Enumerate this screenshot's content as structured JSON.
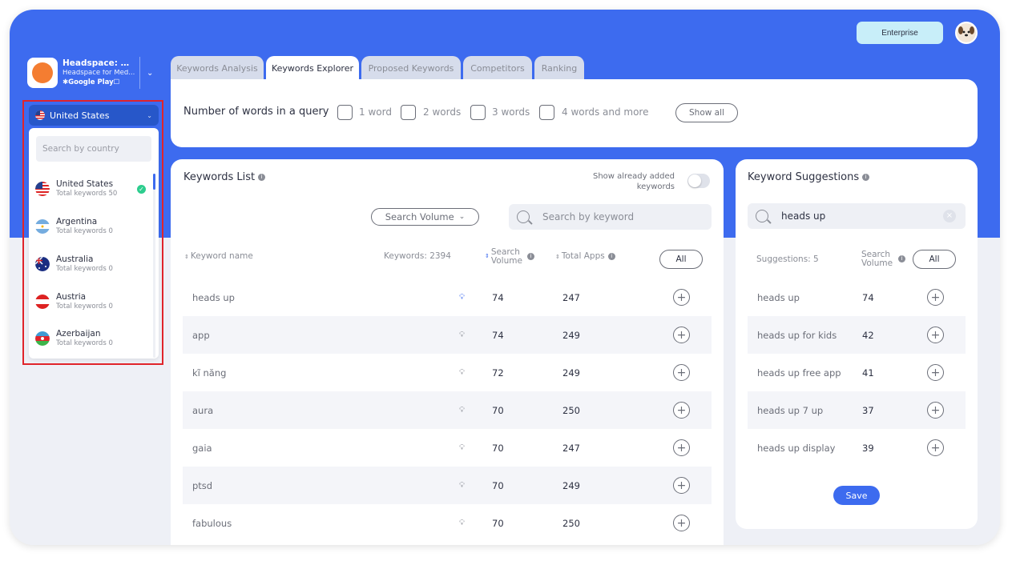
{
  "header": {
    "enterprise_label": "Enterprise"
  },
  "app": {
    "name": "Headspace: Me...",
    "subtitle": "Headspace for Med...",
    "store": "Google Play",
    "icon_color": "#f47d31"
  },
  "country": {
    "selected": "United States",
    "search_placeholder": "Search by country",
    "items": [
      {
        "name": "United States",
        "count": "Total keywords 50",
        "checked": true
      },
      {
        "name": "Argentina",
        "count": "Total keywords 0"
      },
      {
        "name": "Australia",
        "count": "Total keywords 0"
      },
      {
        "name": "Austria",
        "count": "Total keywords 0"
      },
      {
        "name": "Azerbaijan",
        "count": "Total keywords 0"
      }
    ]
  },
  "tabs": [
    {
      "label": "Keywords Analysis"
    },
    {
      "label": "Keywords Explorer",
      "active": true
    },
    {
      "label": "Proposed Keywords"
    },
    {
      "label": "Competitors"
    },
    {
      "label": "Ranking"
    }
  ],
  "words_filter": {
    "label": "Number of words in a query",
    "options": [
      "1 word",
      "2 words",
      "3 words",
      "4 words and more"
    ],
    "show_all": "Show all"
  },
  "keywords_list": {
    "title": "Keywords List",
    "show_already": "Show already added keywords",
    "sort_select": "Search Volume",
    "search_placeholder": "Search by keyword",
    "columns": {
      "name": "Keyword name",
      "count": "Keywords: 2394",
      "volume": "Search Volume",
      "apps": "Total Apps",
      "all": "All"
    },
    "rows": [
      {
        "name": "heads up",
        "volume": "74",
        "apps": "247",
        "bulb_active": true
      },
      {
        "name": "app",
        "volume": "74",
        "apps": "249"
      },
      {
        "name": "kĩ năng",
        "volume": "72",
        "apps": "249"
      },
      {
        "name": "aura",
        "volume": "70",
        "apps": "250"
      },
      {
        "name": "gaia",
        "volume": "70",
        "apps": "247"
      },
      {
        "name": "ptsd",
        "volume": "70",
        "apps": "249"
      },
      {
        "name": "fabulous",
        "volume": "70",
        "apps": "250"
      }
    ]
  },
  "suggestions": {
    "title": "Keyword Suggestions",
    "search_value": "heads up",
    "count_label": "Suggestions: 5",
    "volume_label": "Search Volume",
    "all": "All",
    "save": "Save",
    "rows": [
      {
        "name": "heads up",
        "volume": "74"
      },
      {
        "name": "heads up for kids",
        "volume": "42"
      },
      {
        "name": "heads up free app",
        "volume": "41"
      },
      {
        "name": "heads up 7 up",
        "volume": "37"
      },
      {
        "name": "heads up display",
        "volume": "39"
      }
    ]
  },
  "colors": {
    "brand_blue": "#3d6bef",
    "highlight_red": "#e0242b",
    "success_green": "#2dcd8e"
  }
}
